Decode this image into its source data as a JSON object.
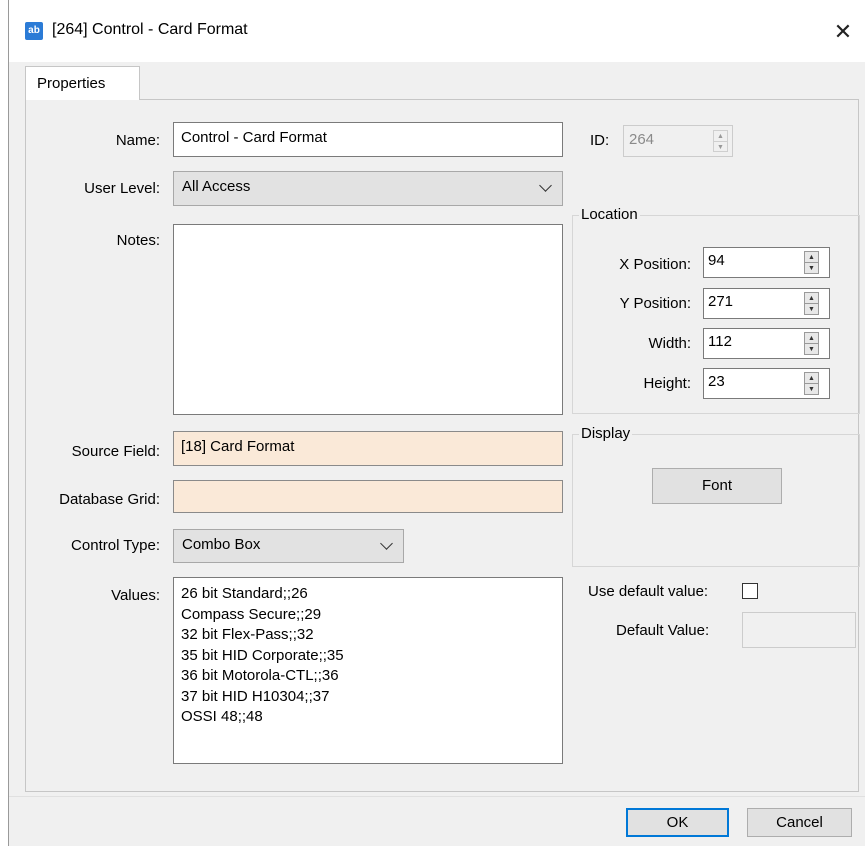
{
  "window": {
    "icon": "ab",
    "title": "[264] Control - Card Format",
    "close_glyph": "✕"
  },
  "tabs": [
    {
      "label": "Properties",
      "active": true
    }
  ],
  "form": {
    "name_label": "Name:",
    "name_value": "Control - Card Format",
    "id_label": "ID:",
    "id_value": "264",
    "user_level_label": "User Level:",
    "user_level_value": "All Access",
    "notes_label": "Notes:",
    "notes_value": "",
    "source_field_label": "Source Field:",
    "source_field_value": "[18] Card Format",
    "database_grid_label": "Database Grid:",
    "database_grid_value": "",
    "control_type_label": "Control Type:",
    "control_type_value": "Combo Box",
    "values_label": "Values:",
    "values": [
      "26 bit Standard;;26",
      "Compass Secure;;29",
      "32 bit Flex-Pass;;32",
      "35 bit HID Corporate;;35",
      "36 bit Motorola-CTL;;36",
      "37 bit HID H10304;;37",
      "OSSI 48;;48"
    ]
  },
  "location": {
    "title": "Location",
    "x_label": "X Position:",
    "x_value": "94",
    "y_label": "Y Position:",
    "y_value": "271",
    "width_label": "Width:",
    "width_value": "112",
    "height_label": "Height:",
    "height_value": "23"
  },
  "display": {
    "title": "Display",
    "font_button": "Font"
  },
  "defaults": {
    "use_default_label": "Use default value:",
    "use_default_checked": false,
    "default_value_label": "Default Value:",
    "default_value": ""
  },
  "footer": {
    "ok_label": "OK",
    "cancel_label": "Cancel"
  },
  "colors": {
    "accent": "#0078d7",
    "peach_field": "#fae9d8",
    "window_bg": "#f0f0f0",
    "app_icon": "#2b7bd6"
  }
}
